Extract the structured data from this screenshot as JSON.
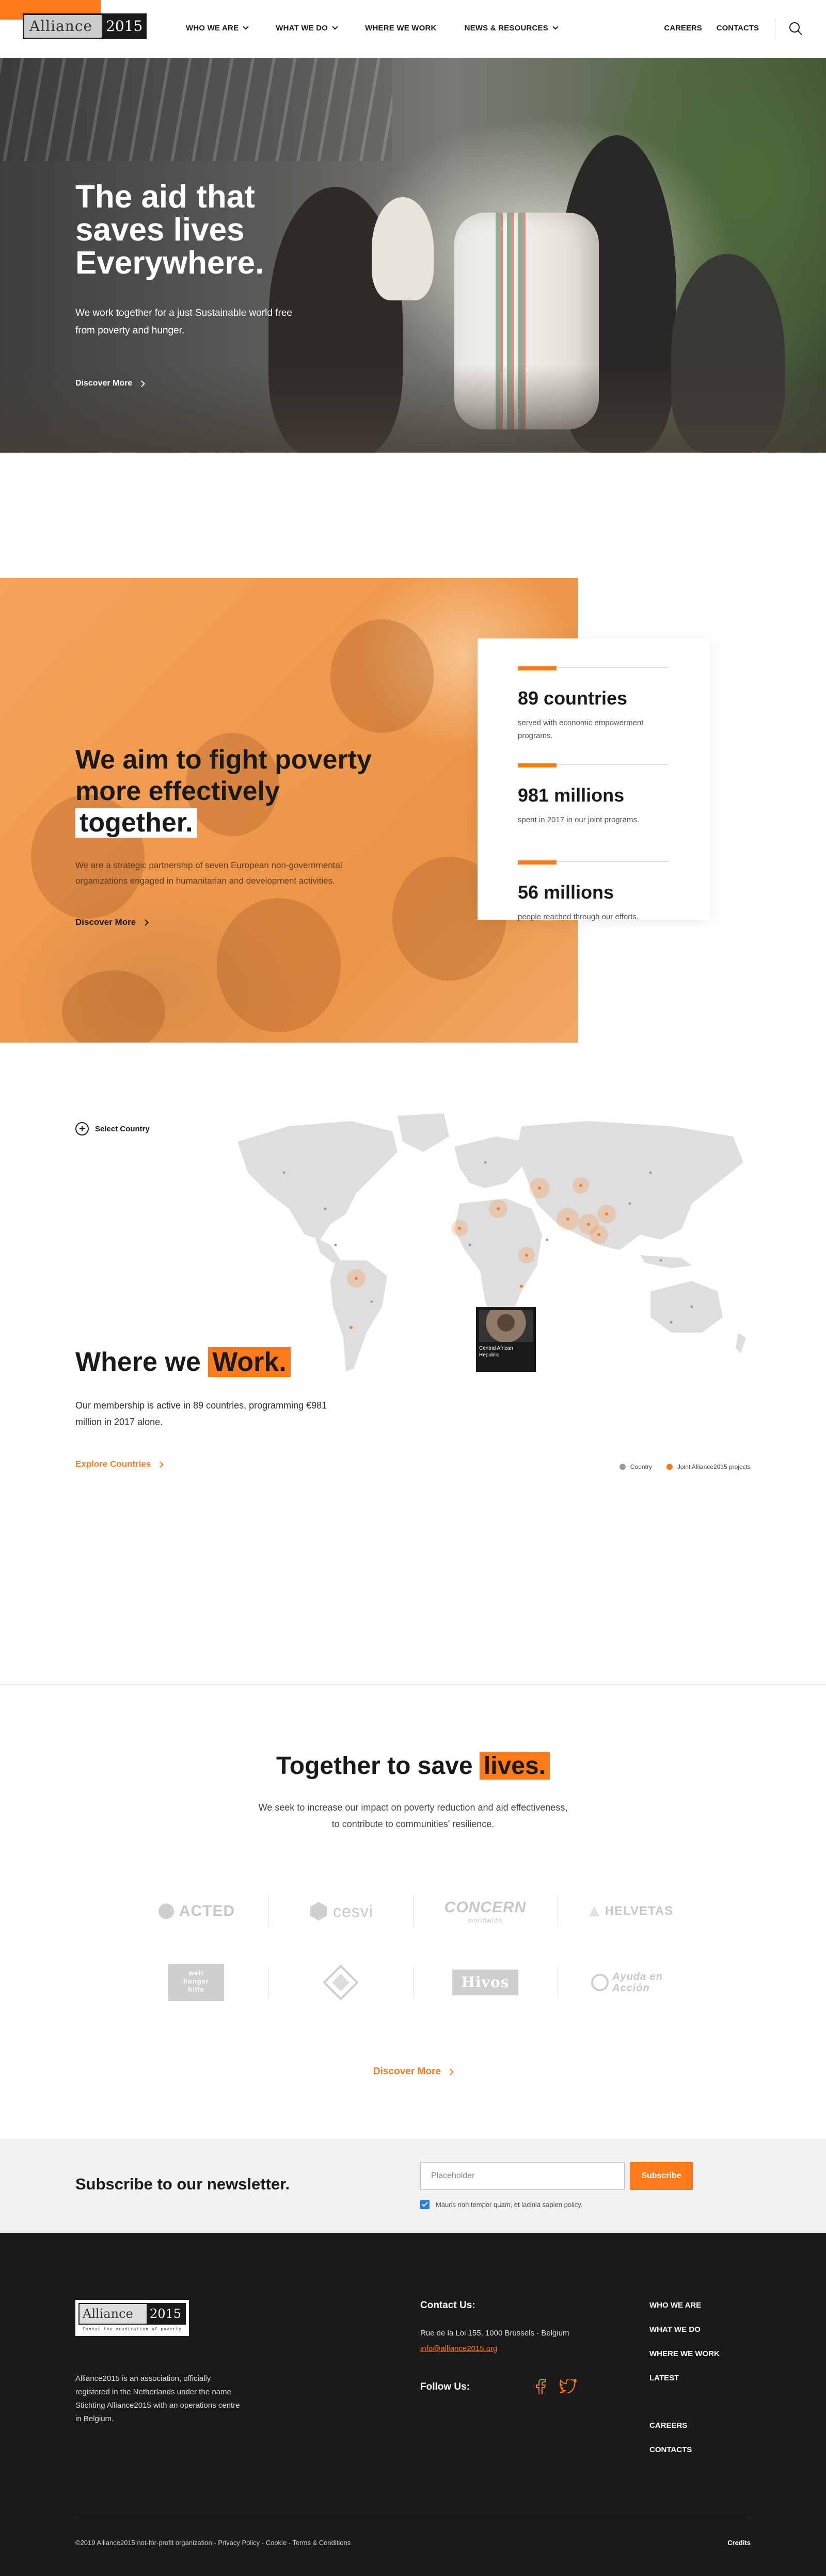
{
  "header": {
    "logo_left": "Alliance",
    "logo_right": "2015",
    "nav": [
      {
        "label": "WHO WE ARE",
        "dropdown": true
      },
      {
        "label": "WHAT WE DO",
        "dropdown": true
      },
      {
        "label": "WHERE WE WORK",
        "dropdown": false
      },
      {
        "label": "NEWS & RESOURCES",
        "dropdown": true
      }
    ],
    "nav_right": [
      "CAREERS",
      "CONTACTS"
    ],
    "search_icon": "search-icon"
  },
  "hero": {
    "title": "The aid that saves lives Everywhere.",
    "subtitle": "We work together for a just Sustainable world free from poverty and hunger.",
    "cta": "Discover More"
  },
  "aim": {
    "title_prefix": "We aim to fight poverty more effectively",
    "title_highlight": "together.",
    "description": "We are a strategic partnership of seven European non-governmental organizations engaged in humanitarian and development activities.",
    "cta": "Discover More",
    "stats": [
      {
        "value": "89 countries",
        "text": "served with economic empowerment programs."
      },
      {
        "value": "981 millions",
        "text": "spent in 2017 in our joint programs."
      },
      {
        "value": "56 millions",
        "text": "people reached through our efforts."
      }
    ]
  },
  "work": {
    "select_label": "Select Country",
    "title_prefix": "Where we",
    "title_highlight": "Work.",
    "description": "Our membership is active in 89 countries, programming €981 million in 2017 alone.",
    "cta": "Explore Countries",
    "tooltip_country": "Central African Republic",
    "legend": [
      {
        "label": "Country",
        "color": "#9a9a9a"
      },
      {
        "label": "Joint Alliance2015 projects",
        "color": "#ff7a1a"
      }
    ]
  },
  "together": {
    "title_prefix": "Together to save",
    "title_highlight": "lives.",
    "description": "We seek to increase our impact on poverty reduction and aid effectiveness, to contribute to communities' resilience.",
    "logos_row1": [
      "ACTED",
      "cesvi",
      "CONCERN",
      "HELVETAS"
    ],
    "logos_row1_sub": [
      "",
      "",
      "worldwide",
      ""
    ],
    "logos_row2": [
      "welt hunger hilfe",
      "",
      "Hivos",
      "Ayuda en Acción"
    ],
    "cta": "Discover More"
  },
  "newsletter": {
    "title": "Subscribe to our newsletter.",
    "placeholder": "Placeholder",
    "button": "Subscribe",
    "consent": "Mauris non tempor quam, et lacinia sapien policy."
  },
  "footer": {
    "logo_left": "Alliance",
    "logo_right": "2015",
    "logo_tagline": "Combat the eradication of poverty",
    "about": "Alliance2015 is an association, officially registered in the Netherlands under the name Stichting Alliance2015 with an operations centre in Belgium.",
    "contact_heading": "Contact Us:",
    "address": "Rue de la Loi 155, 1000 Brussels - Belgium",
    "email": "info@alliance2015.org",
    "follow_heading": "Follow Us:",
    "nav": [
      "WHO WE ARE",
      "WHAT WE DO",
      "WHERE WE WORK",
      "LATEST"
    ],
    "nav2": [
      "CAREERS",
      "CONTACTS"
    ],
    "copyright": "©2019 Alliance2015 not-for-profit organization - Privacy Policy - Cookie - Terms & Conditions",
    "credits": "Credits"
  },
  "colors": {
    "accent": "#ff7a1a",
    "dark": "#1a1a1a",
    "light_bg": "#f2f2f2"
  }
}
